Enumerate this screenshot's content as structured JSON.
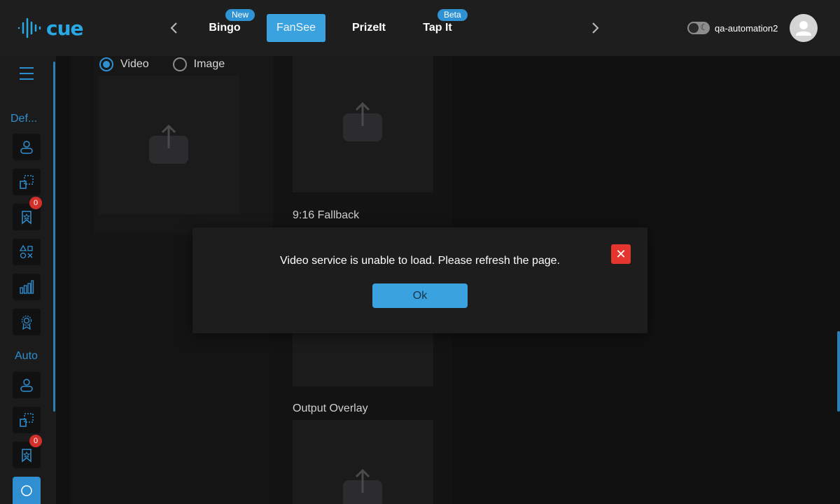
{
  "header": {
    "logo_text": "cue",
    "tabs": [
      {
        "label": "Bingo",
        "badge": "New"
      },
      {
        "label": "FanSee",
        "badge": ""
      },
      {
        "label": "PrizeIt",
        "badge": ""
      },
      {
        "label": "Tap It",
        "badge": "Beta"
      }
    ],
    "username": "qa-automation2"
  },
  "sidebar": {
    "sections": [
      "Def...",
      "Auto"
    ],
    "badge_counts": [
      "0",
      "0"
    ]
  },
  "main": {
    "media_type_options": [
      "Video",
      "Image"
    ],
    "selected_media_type": "Video",
    "fallback_label": "9:16 Fallback",
    "output_overlay_label": "Output Overlay"
  },
  "modal": {
    "message": "Video service is unable to load. Please refresh the page.",
    "ok_label": "Ok",
    "close_glyph": "✕"
  },
  "colors": {
    "accent": "#3aa3df",
    "danger": "#e5352f",
    "background": "#111112"
  }
}
